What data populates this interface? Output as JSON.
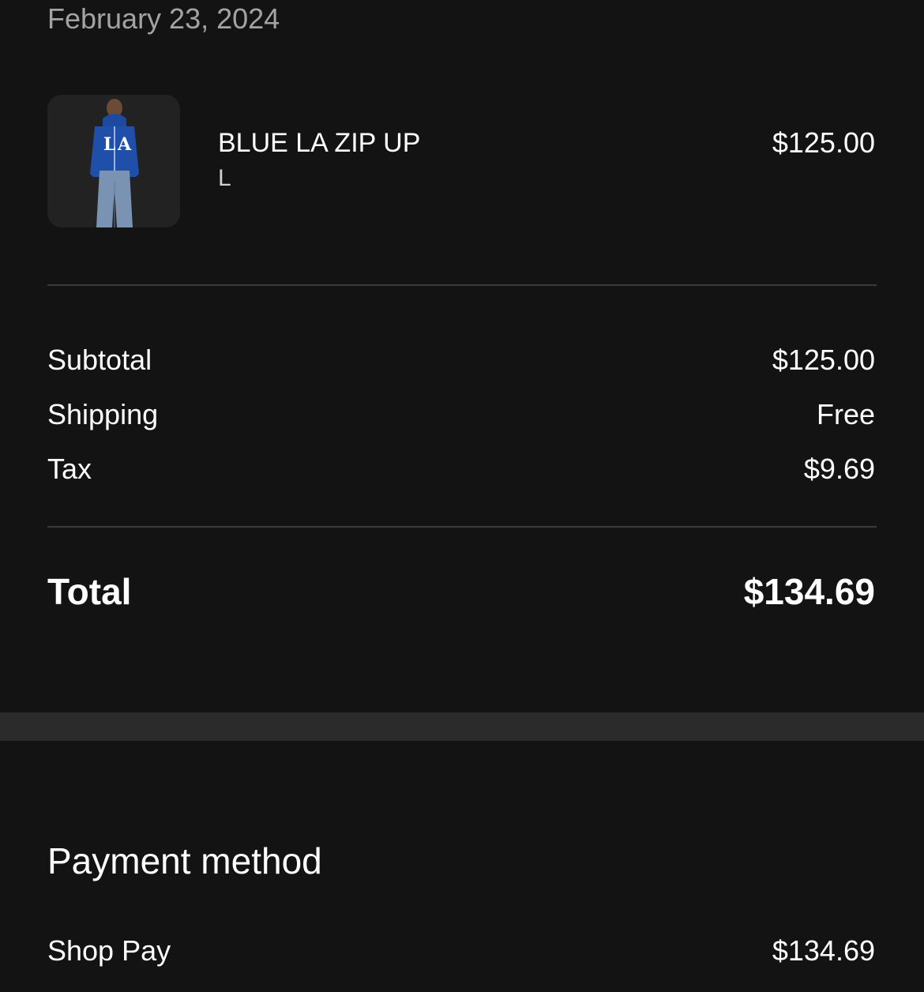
{
  "order": {
    "date": "February 23, 2024"
  },
  "item": {
    "name": "BLUE LA ZIP UP",
    "variant": "L",
    "price": "$125.00",
    "image_icon": "product-photo-blue-zip-hoodie"
  },
  "summary": {
    "rows": [
      {
        "label": "Subtotal",
        "value": "$125.00"
      },
      {
        "label": "Shipping",
        "value": "Free"
      },
      {
        "label": "Tax",
        "value": "$9.69"
      }
    ],
    "total_label": "Total",
    "total_value": "$134.69"
  },
  "payment": {
    "heading": "Payment method",
    "method": "Shop Pay",
    "amount": "$134.69"
  },
  "colors": {
    "background": "#131313",
    "band": "#2b2b2b",
    "divider": "#3a3a3a",
    "muted_text": "#a3a3a3",
    "hoodie_blue": "#1f4fa8"
  }
}
